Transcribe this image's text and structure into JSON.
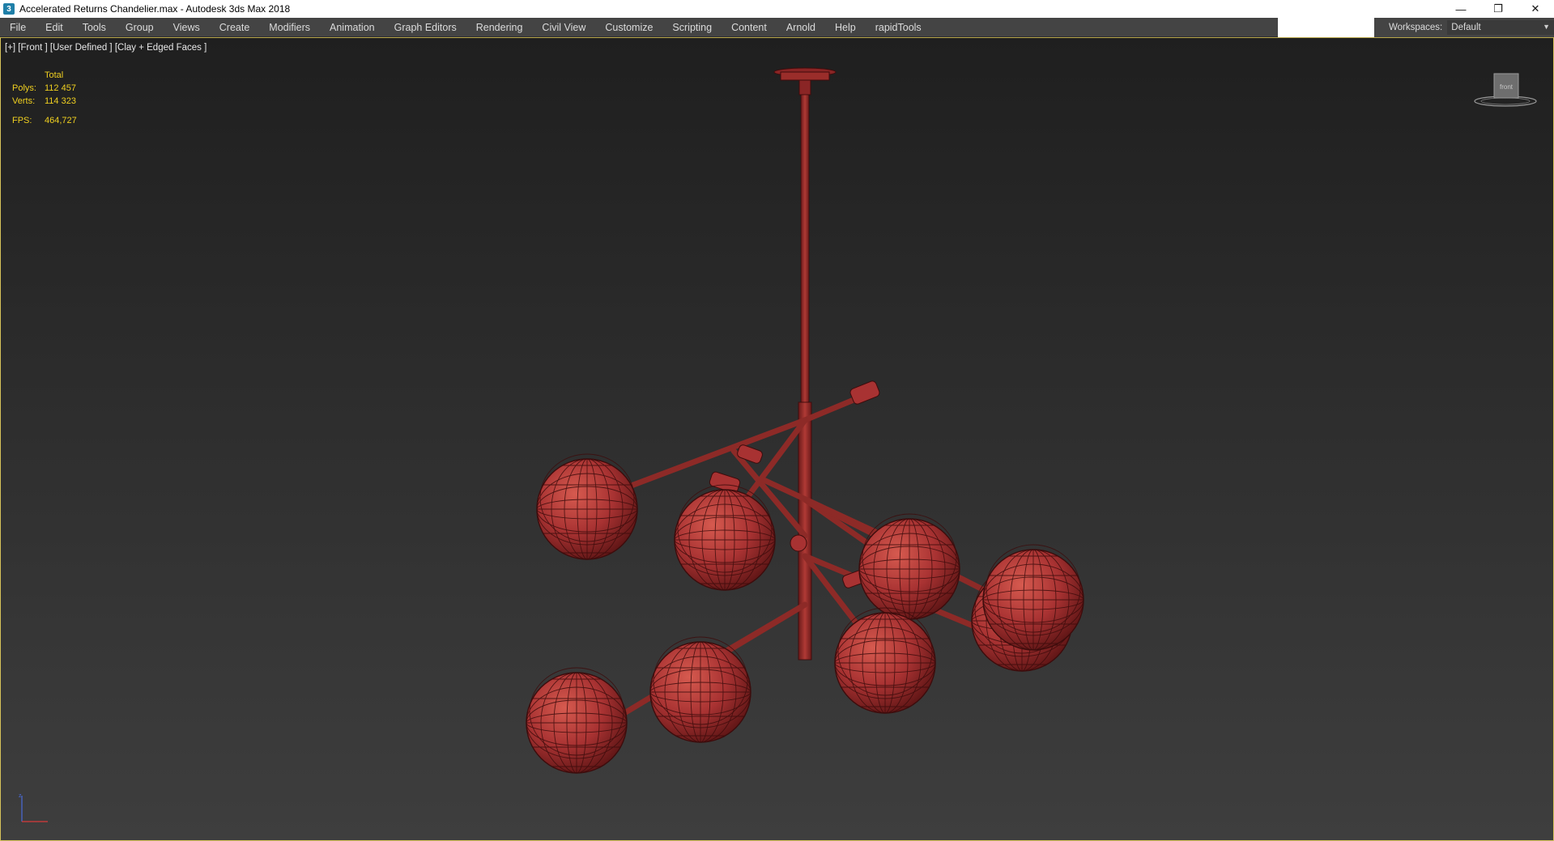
{
  "titlebar": {
    "app_icon": "3ds-max-icon",
    "title": "Accelerated Returns Chandelier.max - Autodesk 3ds Max 2018",
    "controls": [
      "minimize-icon",
      "restore-icon",
      "close-icon"
    ]
  },
  "menubar": {
    "items": [
      "File",
      "Edit",
      "Tools",
      "Group",
      "Views",
      "Create",
      "Modifiers",
      "Animation",
      "Graph Editors",
      "Rendering",
      "Civil View",
      "Customize",
      "Scripting",
      "Content",
      "Arnold",
      "Help",
      "rapidTools"
    ],
    "workspace_label": "Workspaces:",
    "workspace_value": "Default"
  },
  "viewport": {
    "label": "[+] [Front ] [User Defined ] [Clay + Edged Faces ]",
    "stats": {
      "header": "Total",
      "polys_label": "Polys:",
      "polys_value": "112 457",
      "verts_label": "Verts:",
      "verts_value": "114 323",
      "fps_label": "FPS:",
      "fps_value": "464,727"
    },
    "viewcube_face": "front",
    "model_color": "#a83232",
    "border_color": "#d6c25a"
  }
}
